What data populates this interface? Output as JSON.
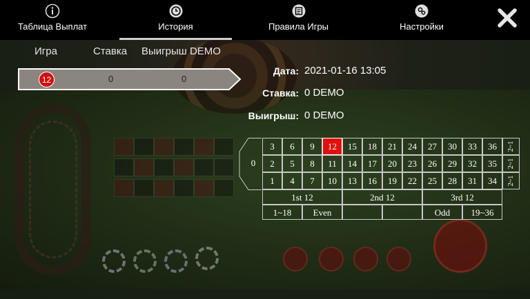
{
  "nav": {
    "tabs": [
      {
        "label": "Таблица Выплат",
        "icon": "info-icon"
      },
      {
        "label": "История",
        "icon": "history-icon",
        "active": true
      },
      {
        "label": "Правила Игры",
        "icon": "rules-icon"
      },
      {
        "label": "Настройки",
        "icon": "settings-icon"
      }
    ],
    "close_icon": "close-icon"
  },
  "history": {
    "headers": [
      "Игра",
      "Ставка",
      "Выигрыш DEMO"
    ],
    "rows": [
      {
        "result": "12",
        "bet": "0",
        "win": "0"
      }
    ]
  },
  "details": {
    "date_label": "Дата:",
    "date_value": "2021-01-16  13:05",
    "bet_label": "Ставка:",
    "bet_value": "0 DEMO",
    "win_label": "Выигрыш:",
    "win_value": "0 DEMO"
  },
  "table": {
    "zero": "0",
    "top_row": [
      "3",
      "6",
      "9",
      "12",
      "15",
      "18",
      "21",
      "24",
      "27",
      "30",
      "33",
      "36"
    ],
    "mid_row": [
      "2",
      "5",
      "8",
      "11",
      "14",
      "17",
      "20",
      "23",
      "26",
      "29",
      "32",
      "35"
    ],
    "bot_row": [
      "1",
      "4",
      "7",
      "10",
      "13",
      "16",
      "19",
      "22",
      "25",
      "28",
      "31",
      "34"
    ],
    "column_bets": [
      "2~1",
      "2~1",
      "2~1"
    ],
    "dozens": [
      "1st 12",
      "2nd 12",
      "3rd 12"
    ],
    "outside": [
      "1~18",
      "Even",
      "",
      "",
      "Odd",
      "19~36"
    ],
    "highlighted": "12",
    "colors": {
      "highlight": "#e0100f",
      "grid_line": "#c9c9c9"
    }
  }
}
